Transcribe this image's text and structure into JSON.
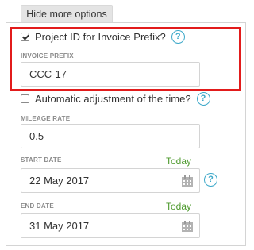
{
  "toolbar": {
    "hide_more_label": "Hide more options"
  },
  "invoice": {
    "checkbox_label": "Project ID for Invoice Prefix?",
    "checked": true,
    "help_glyph": "?",
    "prefix_label": "INVOICE PREFIX",
    "prefix_value": "CCC-17"
  },
  "adjustment": {
    "checkbox_label": "Automatic adjustment of the time?",
    "checked": false,
    "help_glyph": "?"
  },
  "mileage": {
    "label": "MILEAGE RATE",
    "value": "0.5"
  },
  "start_date": {
    "label": "START DATE",
    "today_label": "Today",
    "value": "22 May 2017",
    "help_glyph": "?"
  },
  "end_date": {
    "label": "END DATE",
    "today_label": "Today",
    "value": "31 May 2017"
  },
  "icons": {
    "calendar": "calendar-icon",
    "help": "help-circle-icon"
  },
  "colors": {
    "highlight": "#e21b1b",
    "today": "#4e9a2e",
    "help": "#3da8c9"
  }
}
